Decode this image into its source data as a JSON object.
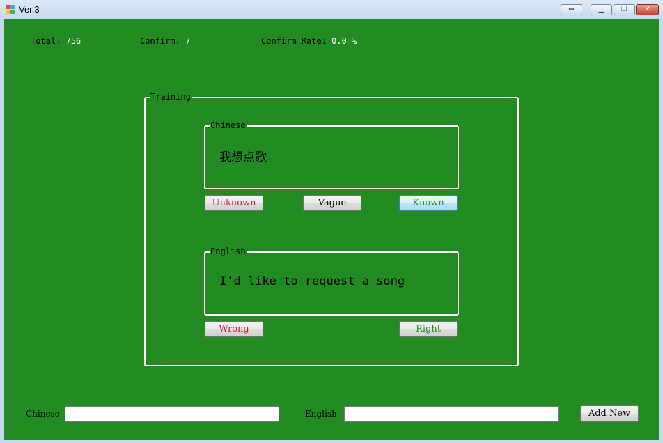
{
  "window": {
    "title": "Ver.3",
    "buttons": [
      "⇔",
      "▁",
      "❐",
      "✕"
    ]
  },
  "stats": {
    "total_label": "Total:",
    "total_value": "756",
    "confirm_label": "Confirm:",
    "confirm_value": "7",
    "rate_label": "Confirm Rate:",
    "rate_value": "0.0 %"
  },
  "training": {
    "legend": "Training",
    "chinese": {
      "legend": "Chinese",
      "text": "我想点歌"
    },
    "chinese_buttons": {
      "unknown": "Unknown",
      "vague": "Vague",
      "known": "Known"
    },
    "english": {
      "legend": "English",
      "text": "I’d like to request a song"
    },
    "english_buttons": {
      "wrong": "Wrong",
      "right": "Right"
    }
  },
  "add_form": {
    "chinese_label": "Chinese",
    "chinese_value": "",
    "english_label": "English",
    "english_value": "",
    "add_button": "Add New"
  },
  "colors": {
    "background": "#228b22",
    "unknown": "#dc143c",
    "wrong": "#dc143c",
    "known": "#228b22",
    "right": "#228b22"
  }
}
